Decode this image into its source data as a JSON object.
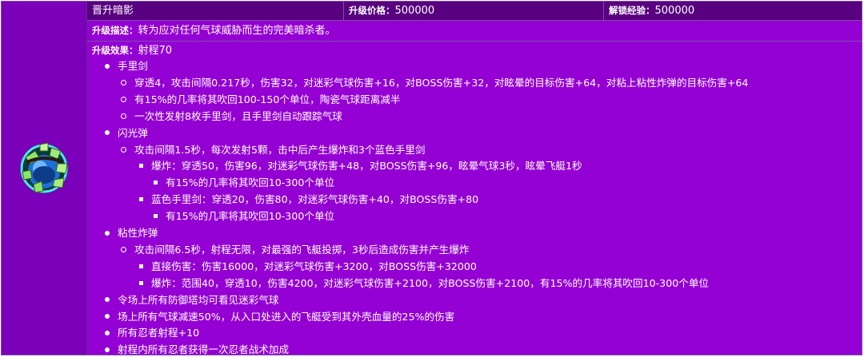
{
  "header": {
    "name": "晋升暗影",
    "price_label": "升级价格：",
    "price_value": "500000",
    "unlock_label": "解锁经验：",
    "unlock_value": "500000"
  },
  "description": {
    "label": "升级描述：",
    "text": "转为应对任何气球威胁而生的完美暗杀者。"
  },
  "effect": {
    "label": "升级效果：",
    "range_text": "射程70",
    "lines": [
      {
        "level": 1,
        "text": "手里剑"
      },
      {
        "level": 2,
        "text": "穿透4，攻击间隔0.217秒，伤害32，对迷彩气球伤害+16，对BOSS伤害+32，对眩晕的目标伤害+64，对粘上粘性炸弹的目标伤害+64"
      },
      {
        "level": 2,
        "text": "有15%的几率将其吹回100-150个单位，陶瓷气球距离减半"
      },
      {
        "level": 2,
        "text": "一次性发射8枚手里剑，且手里剑自动跟踪气球"
      },
      {
        "level": 1,
        "text": "闪光弹"
      },
      {
        "level": 2,
        "text": "攻击间隔1.5秒，每次发射5颗，击中后产生爆炸和3个蓝色手里剑"
      },
      {
        "level": 3,
        "text": "爆炸：穿透50，伤害96，对迷彩气球伤害+48，对BOSS伤害+96，眩晕气球3秒，眩晕飞艇1秒"
      },
      {
        "level": 4,
        "text": "有15%的几率将其吹回10-300个单位"
      },
      {
        "level": 3,
        "text": "蓝色手里剑：穿透20，伤害80，对迷彩气球伤害+40，对BOSS伤害+80"
      },
      {
        "level": 4,
        "text": "有15%的几率将其吹回10-300个单位"
      },
      {
        "level": 1,
        "text": "粘性炸弹"
      },
      {
        "level": 2,
        "text": "攻击间隔6.5秒，射程无限，对最强的飞艇投掷，3秒后造成伤害并产生爆炸"
      },
      {
        "level": 3,
        "text": "直接伤害：伤害16000，对迷彩气球伤害+3200，对BOSS伤害+32000"
      },
      {
        "level": 3,
        "text": "爆炸：范围40，穿透10，伤害4200，对迷彩气球伤害+2100，对BOSS伤害+2100，有15%的几率将其吹回10-300个单位"
      },
      {
        "level": 1,
        "text": "令场上所有防御塔均可看见迷彩气球"
      },
      {
        "level": 1,
        "text": "场上所有气球减速50%，从入口处进入的飞艇受到其外壳血量的25%的伤害"
      },
      {
        "level": 1,
        "text": "所有忍者射程+10"
      },
      {
        "level": 1,
        "text": "射程内所有忍者获得一次忍者战术加成"
      }
    ]
  },
  "icon": {
    "name": "grandmaster-ninja-icon"
  },
  "colors": {
    "header_bg": "#58007f",
    "body_bg": "#9400d3",
    "icon_col_bg": "#7b00b9",
    "border": "#7c4fa8"
  }
}
